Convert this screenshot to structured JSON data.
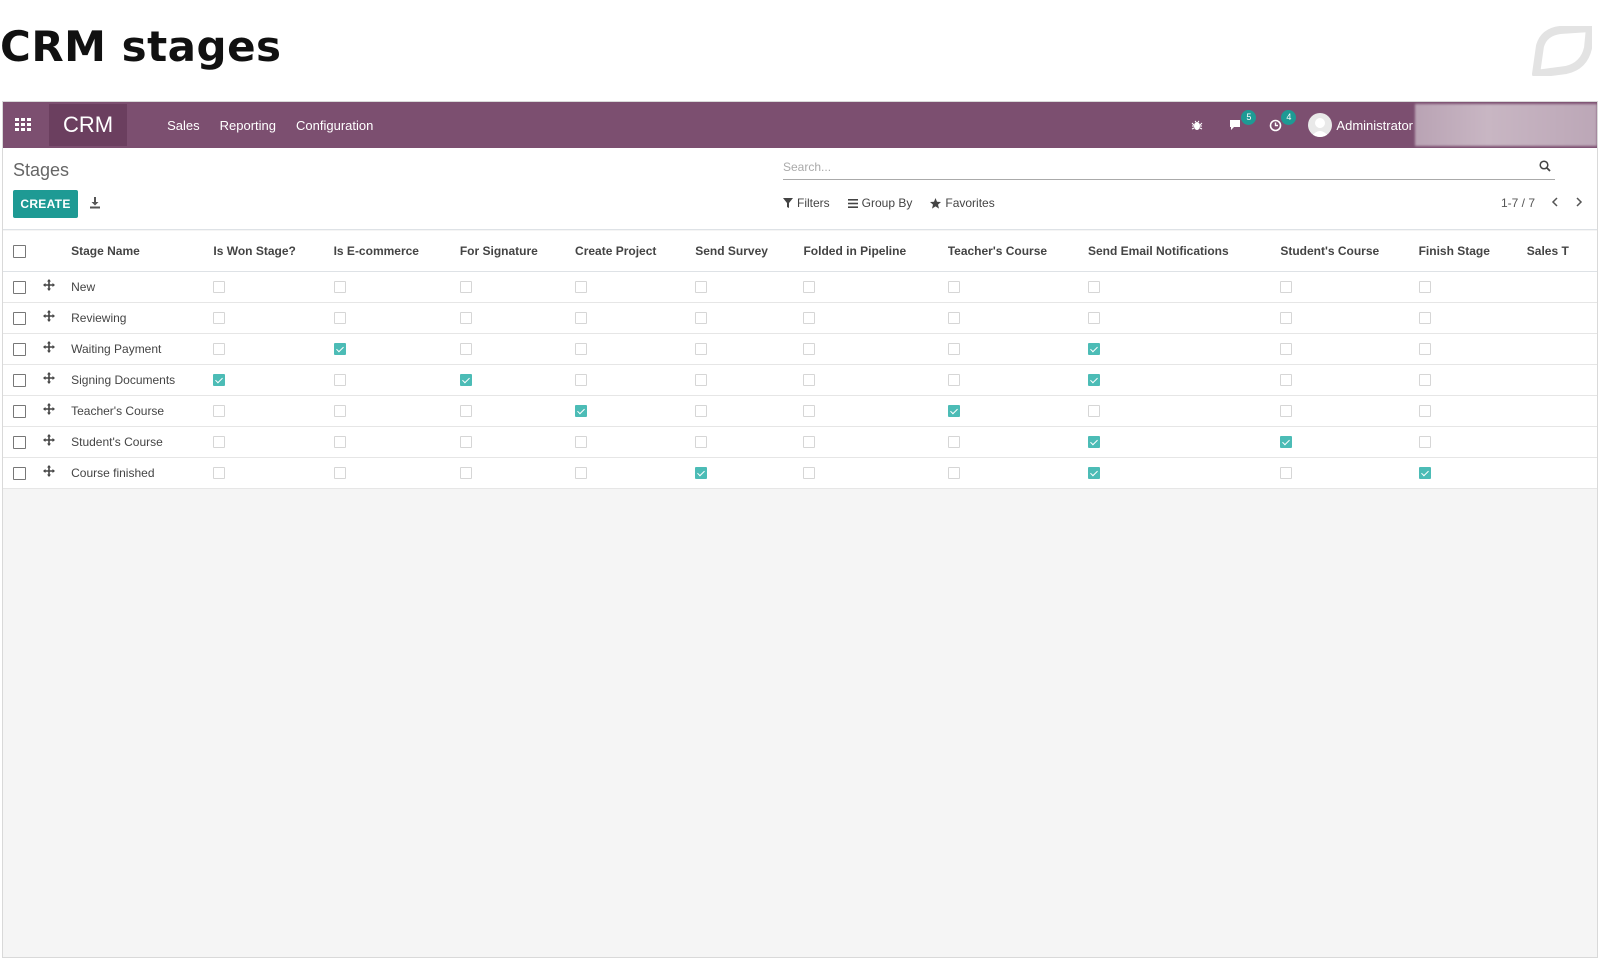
{
  "page": {
    "title": "CRM stages"
  },
  "navbar": {
    "app_name": "CRM",
    "menu": [
      "Sales",
      "Reporting",
      "Configuration"
    ],
    "messages_count": "5",
    "activities_count": "4",
    "user": "Administrator"
  },
  "control_panel": {
    "breadcrumb": "Stages",
    "create_label": "CREATE",
    "search_placeholder": "Search...",
    "filters_label": "Filters",
    "group_by_label": "Group By",
    "favorites_label": "Favorites",
    "pager": "1-7 / 7"
  },
  "table": {
    "columns": [
      "Stage Name",
      "Is Won Stage?",
      "Is E-commerce",
      "For Signature",
      "Create Project",
      "Send Survey",
      "Folded in Pipeline",
      "Teacher's Course",
      "Send Email Notifications",
      "Student's Course",
      "Finish Stage",
      "Sales T"
    ],
    "rows": [
      {
        "name": "New",
        "flags": [
          false,
          false,
          false,
          false,
          false,
          false,
          false,
          false,
          false,
          false
        ]
      },
      {
        "name": "Reviewing",
        "flags": [
          false,
          false,
          false,
          false,
          false,
          false,
          false,
          false,
          false,
          false
        ]
      },
      {
        "name": "Waiting Payment",
        "flags": [
          false,
          true,
          false,
          false,
          false,
          false,
          false,
          true,
          false,
          false
        ]
      },
      {
        "name": "Signing Documents",
        "flags": [
          true,
          false,
          true,
          false,
          false,
          false,
          false,
          true,
          false,
          false
        ]
      },
      {
        "name": "Teacher's Course",
        "flags": [
          false,
          false,
          false,
          true,
          false,
          false,
          true,
          false,
          false,
          false
        ]
      },
      {
        "name": "Student's Course",
        "flags": [
          false,
          false,
          false,
          false,
          false,
          false,
          false,
          true,
          true,
          false
        ]
      },
      {
        "name": "Course finished",
        "flags": [
          false,
          false,
          false,
          false,
          true,
          false,
          false,
          true,
          false,
          true
        ]
      }
    ]
  },
  "colors": {
    "navbar": "#7c4f70",
    "accent": "#1e9a94",
    "checked": "#4cbcb6"
  }
}
